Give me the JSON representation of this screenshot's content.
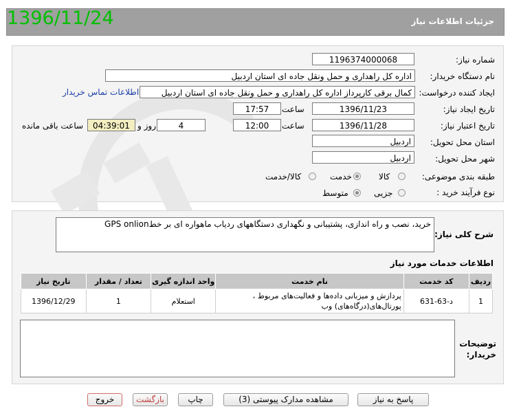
{
  "overlay_date": "1396/11/24",
  "header": {
    "title": "جزئیات اطلاعات نیاز"
  },
  "form": {
    "need_number": {
      "label": "شماره نیاز:",
      "value": "1196374000068"
    },
    "buyer_org": {
      "label": "نام دستگاه خریدار:",
      "value": "اداره کل راهداری و حمل ونقل جاده ای استان اردبیل"
    },
    "requester": {
      "label": "ایجاد کننده درخواست:",
      "value": "کمال برقی کارپرداز اداره کل راهداری و حمل ونقل جاده ای استان اردبیل",
      "contact_link": "اطلاعات تماس خریدار"
    },
    "created": {
      "label": "تاریخ ایجاد نیاز:",
      "date": "1396/11/23",
      "time_label": "ساعت",
      "time": "17:57"
    },
    "validity": {
      "label": "تاریخ اعتبار نیاز:",
      "date": "1396/11/28",
      "time_label": "ساعت",
      "time": "12:00",
      "days": "4",
      "days_label": "روز و",
      "countdown": "04:39:01",
      "remaining_label": "ساعت باقی مانده"
    },
    "province": {
      "label": "استان محل تحویل:",
      "value": "اردبیل"
    },
    "city": {
      "label": "شهر محل تحویل:",
      "value": "اردبیل"
    },
    "category": {
      "label": "طبقه بندی موضوعی:",
      "options": [
        "کالا",
        "خدمت",
        "کالا/خدمت"
      ],
      "selected": "خدمت"
    },
    "purchase_type": {
      "label": "نوع فرآیند خرید :",
      "options": [
        "جزیی",
        "متوسط"
      ],
      "selected": "متوسط"
    }
  },
  "description": {
    "label": "شرح کلی نیاز:",
    "value": "خرید، نصب و راه اندازی، پشتیبانی و نگهداری دستگاههای ردیاب ماهواره ای بر خطGPS onlion"
  },
  "services": {
    "title": "اطلاعات خدمات مورد نیاز",
    "columns": [
      "ردیف",
      "کد خدمت",
      "نام خدمت",
      "واحد اندازه گیری",
      "تعداد / مقدار",
      "تاریخ نیاز"
    ],
    "rows": [
      {
        "row": "1",
        "code": "د-63-631",
        "name": "پردازش و میزبانی داده‌ها و فعالیت‌های مربوط ، پورتال‌های(درگاه‌های) وب",
        "unit": "استعلام",
        "qty": "1",
        "date": "1396/12/29"
      }
    ]
  },
  "buyer_notes": {
    "label": "توضیحات خریدار:",
    "value": ""
  },
  "buttons": {
    "reply": "پاسخ به نیاز",
    "attachments": "مشاهده مدارک پیوستی (3)",
    "print": "چاپ",
    "back": "بازگشت",
    "exit": "خروج"
  },
  "colors": {
    "header_bg": "#a0a0a0",
    "overlay_date": "#00c000",
    "countdown_bg": "#f3eec0",
    "link": "#1a3fa8",
    "exit_border": "#d46a6a"
  }
}
